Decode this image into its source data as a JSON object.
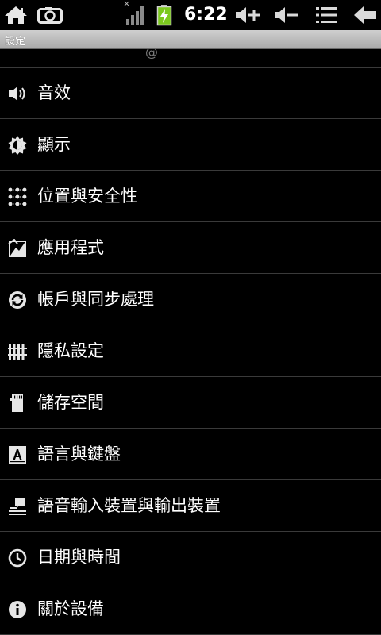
{
  "status_bar": {
    "time": "6:22",
    "icons": [
      "home-icon",
      "screenshot-icon",
      "no-signal-icon",
      "battery-charging-icon",
      "volume-up-icon",
      "volume-down-icon",
      "menu-icon",
      "back-icon"
    ],
    "no_signal_mark": "×"
  },
  "title_bar": {
    "title": "設定"
  },
  "settings": {
    "partial_glyph": "@",
    "items": [
      {
        "label": "音效",
        "icon": "speaker-icon"
      },
      {
        "label": "顯示",
        "icon": "brightness-icon"
      },
      {
        "label": "位置與安全性",
        "icon": "location-grid-icon"
      },
      {
        "label": "應用程式",
        "icon": "applications-icon"
      },
      {
        "label": "帳戶與同步處理",
        "icon": "sync-icon"
      },
      {
        "label": "隱私設定",
        "icon": "privacy-fence-icon"
      },
      {
        "label": "儲存空間",
        "icon": "sd-card-icon"
      },
      {
        "label": "語言與鍵盤",
        "icon": "language-keyboard-icon"
      },
      {
        "label": "語音輸入裝置與輸出裝置",
        "icon": "voice-io-icon"
      },
      {
        "label": "日期與時間",
        "icon": "clock-icon"
      },
      {
        "label": "關於設備",
        "icon": "info-icon"
      }
    ]
  }
}
